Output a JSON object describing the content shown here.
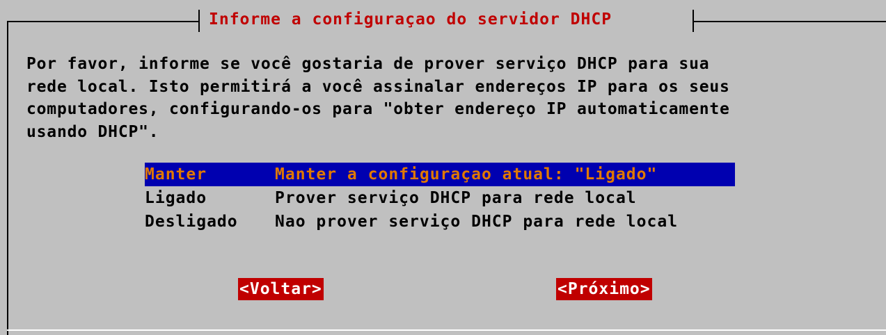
{
  "dialog": {
    "title": "Informe a configuraçao do servidor DHCP",
    "description": "Por favor, informe se você gostaria de prover serviço DHCP para sua\nrede local. Isto permitirá a você assinalar endereços IP para os seus\ncomputadores, configurando-os para \"obter endereço IP automaticamente\nusando DHCP\".",
    "menu": [
      {
        "tag": "Manter",
        "desc": "Manter a configuraçao atual: \"Ligado\"",
        "selected": true
      },
      {
        "tag": "Ligado",
        "desc": "Prover serviço DHCP para rede local",
        "selected": false
      },
      {
        "tag": "Desligado",
        "desc": "Nao prover serviço DHCP para rede local",
        "selected": false
      }
    ],
    "buttons": {
      "back": "<Voltar>",
      "next": "<Próximo>"
    }
  },
  "colors": {
    "background": "#c0c0c0",
    "title": "#c00000",
    "selected_bg": "#0000b0",
    "selected_fg": "#e07800",
    "button_bg": "#c00000",
    "button_fg": "#ffffff"
  }
}
